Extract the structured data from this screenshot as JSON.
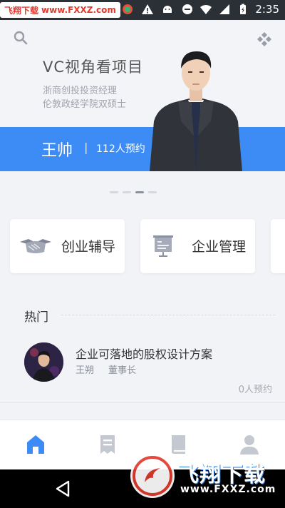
{
  "status_bar": {
    "watermark_left_a": "飞翔下载",
    "watermark_left_b": "www.FXXZ.com",
    "time": "2:35"
  },
  "hero": {
    "title": "VC视角看项目",
    "subtitle1": "浙商创投投资经理",
    "subtitle2": "伦敦政经学院双硕士",
    "name": "王帅",
    "separator": "|",
    "booked": "112人预约"
  },
  "categories": [
    {
      "label": "创业辅导",
      "icon": "handshake-icon"
    },
    {
      "label": "企业管理",
      "icon": "presentation-icon"
    }
  ],
  "hot": {
    "title": "热门",
    "items": [
      {
        "course": "企业可落地的股权设计方案",
        "teacher": "王朔",
        "role": "董事长",
        "booked": "0人预约"
      }
    ]
  },
  "tabs": [
    {
      "icon": "home-icon",
      "active": true
    },
    {
      "icon": "receipt-icon",
      "active": false
    },
    {
      "icon": "book-icon",
      "active": false
    },
    {
      "icon": "user-icon",
      "active": false
    }
  ],
  "watermark": {
    "main": "飞翔下载",
    "url": "www.FXXZ.com"
  },
  "colors": {
    "accent": "#3d8cf6",
    "tab_active": "#3d8cf6",
    "tab_inactive": "#c4c8d0"
  }
}
